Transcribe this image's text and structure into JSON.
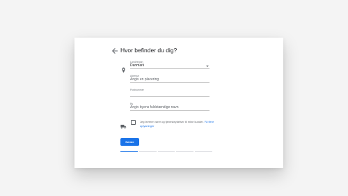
{
  "page": {
    "title": "Hvor befinder du dig?"
  },
  "form": {
    "country": {
      "label": "Land/region",
      "value": "Danmark"
    },
    "address": {
      "label": "Adresse",
      "placeholder": "Angiv en placering"
    },
    "postal": {
      "label": "Postnummer",
      "placeholder": ""
    },
    "city": {
      "label": "By",
      "placeholder": "Angiv byens fuldstændige navn"
    },
    "delivery": {
      "text": "Jeg leverer varer og tjenesteydelser til mine kunder.",
      "link": "Få flere oplysninger",
      "checked": false
    }
  },
  "actions": {
    "next_label": "Næste"
  },
  "progress": {
    "steps_total": 5,
    "current_step": 1
  },
  "colors": {
    "accent": "#1a73e8",
    "card": "#ffffff",
    "background": "#f4f4f4"
  },
  "icons": {
    "back": "arrow-back-icon",
    "location": "location-pin-icon",
    "delivery": "truck-icon",
    "dropdown": "caret-down-icon"
  }
}
